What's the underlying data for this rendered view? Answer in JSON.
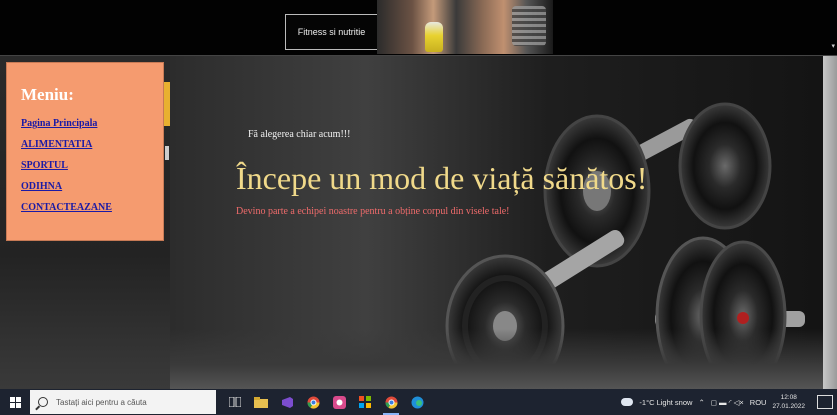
{
  "banner": {
    "title": "Fitness si nutritie"
  },
  "menu": {
    "heading": "Meniu:",
    "links": [
      {
        "label": "Pagina Principala"
      },
      {
        "label": "ALIMENTATIA"
      },
      {
        "label": "SPORTUL"
      },
      {
        "label": "ODIHNA"
      },
      {
        "label": "CONTACTEAZANE"
      }
    ],
    "box_color": "#f59b6f",
    "link_color": "#1a1aa6"
  },
  "hero": {
    "tagline": "Fă alegerea chiar acum!!!",
    "title": "Începe un mod de viață sănătos!",
    "subtitle": "Devino parte a echipei noastre pentru a obține corpul din visele tale!",
    "title_color": "#f0d98a",
    "subtitle_color": "#ef6b6b"
  },
  "taskbar": {
    "search_placeholder": "Tastați aici pentru a căuta",
    "apps": [
      {
        "icon": "task-view-icon"
      },
      {
        "icon": "file-explorer-icon"
      },
      {
        "icon": "visual-studio-icon"
      },
      {
        "icon": "chrome-icon"
      },
      {
        "icon": "app-icon"
      },
      {
        "icon": "ms-store-icon"
      },
      {
        "icon": "chrome-icon"
      },
      {
        "icon": "edge-icon"
      }
    ],
    "weather": "-1°C Light snow",
    "language": "ROU",
    "time": "12:08",
    "date": "27.01.2022"
  }
}
